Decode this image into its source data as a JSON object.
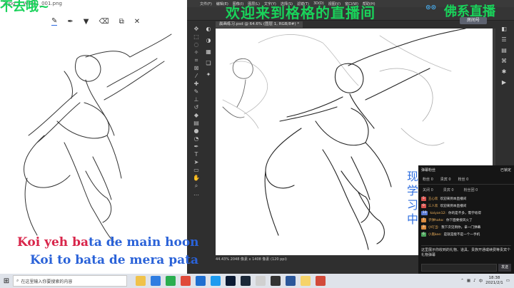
{
  "left_pane": {
    "doc_tab": "2.jpg 1_Ver@1_001.png",
    "overlay_text": "不去哦~",
    "toolbar_icons": [
      "pen-icon",
      "pen-alt-icon",
      "marker-icon",
      "eraser-icon",
      "copy-icon",
      "close-icon"
    ]
  },
  "photoshop": {
    "menu": [
      "文件(F)",
      "编辑(E)",
      "图像(I)",
      "图层(L)",
      "文字(Y)",
      "选择(S)",
      "滤镜(T)",
      "3D(D)",
      "视图(V)",
      "窗口(W)",
      "帮助(H)"
    ],
    "doc_tab": "晨画练习.psd @ 64.6% (图层 1, RGB/8#) *",
    "status": "44.43%   2048 像素 x 1408 像素 (120 ppi)",
    "tools": [
      "move-icon",
      "marquee-icon",
      "lasso-icon",
      "quick-select-icon",
      "crop-icon",
      "frame-icon",
      "eyedropper-icon",
      "heal-icon",
      "brush-icon",
      "stamp-icon",
      "history-brush-icon",
      "eraser-icon",
      "gradient-icon",
      "blur-icon",
      "dodge-icon",
      "pen-icon",
      "type-icon",
      "path-select-icon",
      "shape-icon",
      "hand-icon",
      "zoom-icon",
      "more-icon"
    ]
  },
  "stream": {
    "title": "欢迎来到格格的直播间",
    "brand": "佛系直播",
    "room_badge": "房间号",
    "side_text": "现 学 习 中",
    "lyric1_red": "Koi yeh ba",
    "lyric1_blue": "ta de main hoon",
    "lyric2": "Koi to bata de mera pata"
  },
  "chat": {
    "header": "弹幕粉丝",
    "header_right": "已锁定",
    "tabs": [
      "粉丝 0",
      "贵宾 0",
      "粉丝 0"
    ],
    "sub": [
      "关闭 0",
      "贵宾 0",
      "粉丝团 0"
    ],
    "messages": [
      {
        "badge": "5",
        "badge_color": "#d9534f",
        "user": "王心欢",
        "text": "欢迎来到本直播间"
      },
      {
        "badge": "0",
        "badge_color": "#d9534f",
        "user": "三人欢",
        "text": "欢迎来到本直播间"
      },
      {
        "badge": "10",
        "badge_color": "#5b7bd5",
        "user": "kaiyan12:",
        "text": "你的是不多，需学啥得"
      },
      {
        "badge": "7",
        "badge_color": "#d98a3f",
        "user": "子弹haha:",
        "text": "你下面要接风火了"
      },
      {
        "badge": "3",
        "badge_color": "#d98a3f",
        "user": "小叮当:",
        "text": "我下次见到你，拿一门弹幕"
      },
      {
        "badge": "6",
        "badge_color": "#4aa35a",
        "user": "小黑kee:",
        "text": "是就是能不是一个一手机"
      }
    ],
    "footer": "这里展示你收到的礼物、道具、贵族开通或续费等贵宾个礼物弹幕",
    "send_label": "发送"
  },
  "taskbar": {
    "search_placeholder": "在这里输入你要搜索的内容",
    "time": "18:38",
    "date": "2021/2/1",
    "tray_lang": "中",
    "app_icons": [
      "file-explorer-icon",
      "edge-icon",
      "wechat-icon",
      "chrome-icon",
      "mail-icon",
      "qq-icon",
      "photoshop-icon",
      "steam-icon",
      "clip-studio-icon",
      "obs-icon",
      "word-icon",
      "folder-icon",
      "video-icon"
    ]
  }
}
